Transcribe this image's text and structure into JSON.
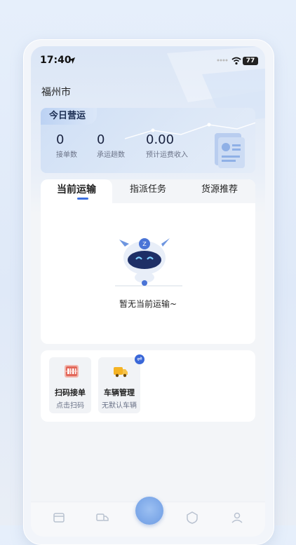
{
  "status_bar": {
    "time": "17:40",
    "battery": "77"
  },
  "location": {
    "city": "福州市"
  },
  "operations": {
    "badge": "今日营运",
    "stats": [
      {
        "value": "0",
        "label": "接单数"
      },
      {
        "value": "0",
        "label": "承运趟数"
      },
      {
        "value": "0.00",
        "label": "预计运费收入"
      }
    ]
  },
  "tabs": {
    "items": [
      {
        "label": "当前运输",
        "active": true
      },
      {
        "label": "指派任务",
        "active": false
      },
      {
        "label": "货源推荐",
        "active": false
      }
    ]
  },
  "empty_state": {
    "message": "暂无当前运输~"
  },
  "quick_actions": [
    {
      "title": "扫码接单",
      "subtitle": "点击扫码",
      "icon": "scan-qr-icon"
    },
    {
      "title": "车辆管理",
      "subtitle": "无默认车辆",
      "icon": "truck-icon",
      "badge_icon": "swap-icon"
    }
  ],
  "colors": {
    "accent": "#3b6fe0",
    "badge": "#3a67d8",
    "scan_icon": "#e2675a",
    "truck_icon": "#f5b324"
  },
  "bottom_nav": {
    "icons": [
      "orders-icon",
      "truck-nav-icon",
      "center-logo-icon",
      "shield-icon",
      "profile-icon"
    ]
  }
}
